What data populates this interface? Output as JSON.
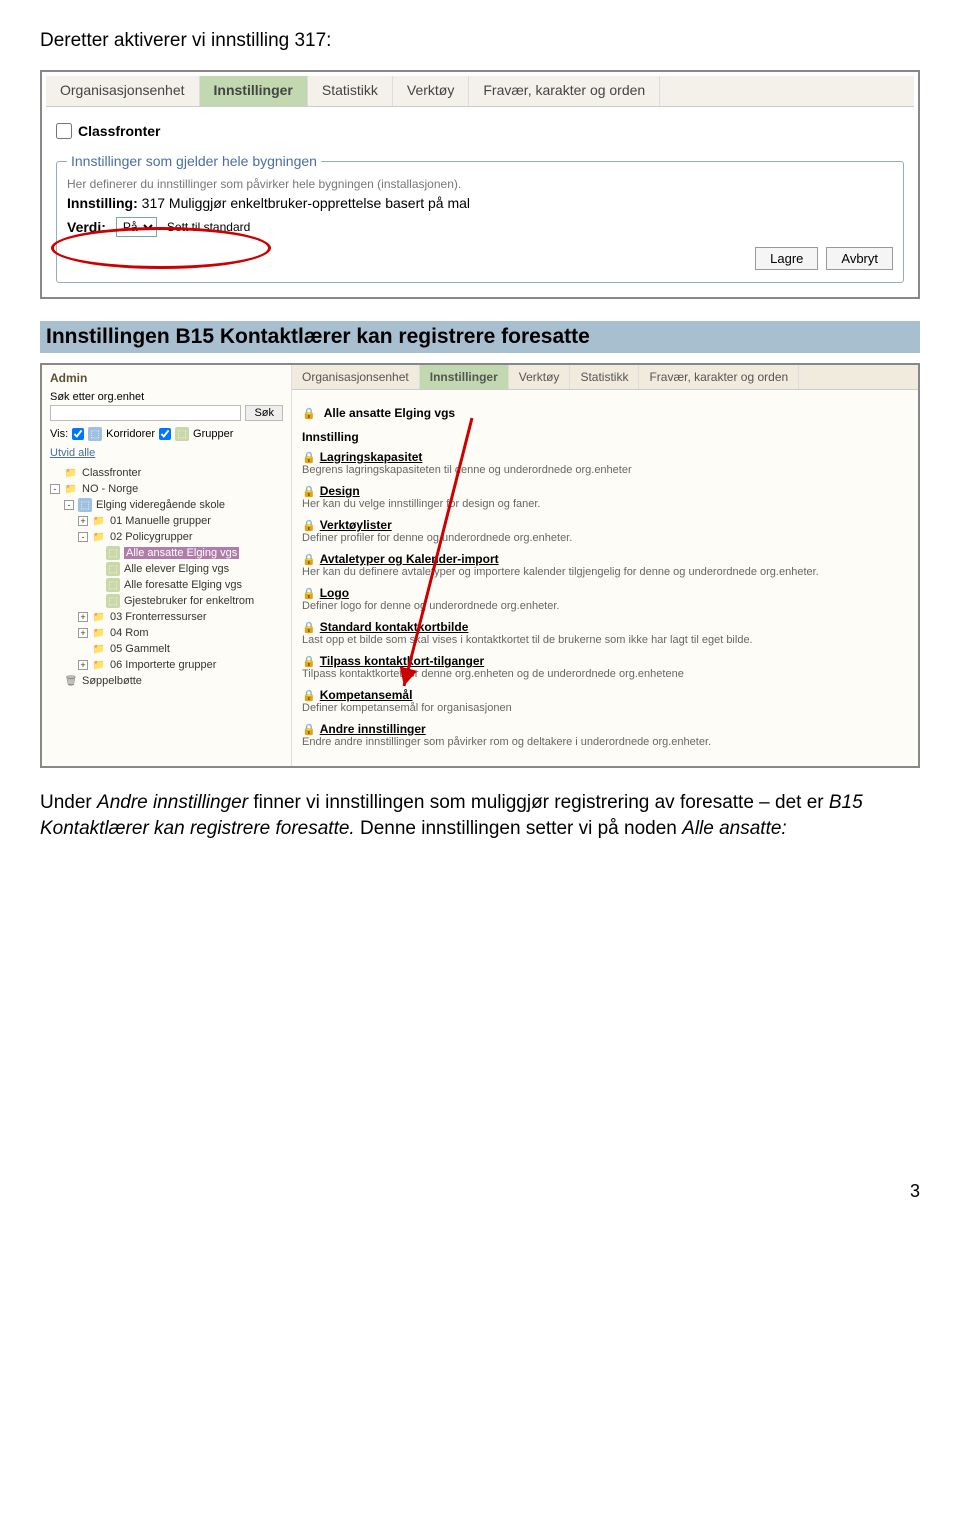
{
  "intro": "Deretter aktiverer vi innstilling 317:",
  "heading": "Innstillingen B15 Kontaktlærer kan registrere foresatte",
  "ss1": {
    "tabs": [
      "Organisasjonsenhet",
      "Innstillinger",
      "Statistikk",
      "Verktøy",
      "Fravær, karakter og orden"
    ],
    "active_tab": 1,
    "checkbox_label": "Classfronter",
    "fieldset_legend": "Innstillinger som gjelder hele bygningen",
    "fieldset_desc": "Her definerer du innstillinger som påvirker hele bygningen (installasjonen).",
    "setting_label": "Innstilling:",
    "setting_text": "317 Muliggjør enkeltbruker-opprettelse basert på mal",
    "verdi_label": "Verdi:",
    "verdi_value": "På",
    "reset_link": "Sett til standard",
    "buttons": [
      "Lagre",
      "Avbryt"
    ]
  },
  "ss2": {
    "admin": "Admin",
    "search_label": "Søk etter org.enhet",
    "search_btn": "Søk",
    "vis_label": "Vis:",
    "korridorer": "Korridorer",
    "grupper": "Grupper",
    "expand": "Utvid alle",
    "tree": [
      {
        "indent": 0,
        "pm": "",
        "icon": "f",
        "label": "Classfronter"
      },
      {
        "indent": 0,
        "pm": "-",
        "icon": "f",
        "label": "NO - Norge"
      },
      {
        "indent": 1,
        "pm": "-",
        "icon": "k",
        "label": "Elging videregående skole"
      },
      {
        "indent": 2,
        "pm": "+",
        "icon": "f",
        "label": "01 Manuelle grupper"
      },
      {
        "indent": 2,
        "pm": "-",
        "icon": "f",
        "label": "02 Policygrupper"
      },
      {
        "indent": 3,
        "pm": "",
        "icon": "g",
        "label": "Alle ansatte Elging vgs",
        "selected": true
      },
      {
        "indent": 3,
        "pm": "",
        "icon": "g",
        "label": "Alle elever Elging vgs"
      },
      {
        "indent": 3,
        "pm": "",
        "icon": "g",
        "label": "Alle foresatte Elging vgs"
      },
      {
        "indent": 3,
        "pm": "",
        "icon": "g",
        "label": "Gjestebruker for enkeltrom"
      },
      {
        "indent": 2,
        "pm": "+",
        "icon": "f",
        "label": "03 Fronterressurser"
      },
      {
        "indent": 2,
        "pm": "+",
        "icon": "f",
        "label": "04 Rom"
      },
      {
        "indent": 2,
        "pm": "",
        "icon": "f",
        "label": "05 Gammelt"
      },
      {
        "indent": 2,
        "pm": "+",
        "icon": "f",
        "label": "06 Importerte grupper"
      },
      {
        "indent": 0,
        "pm": "",
        "icon": "trash",
        "label": "Søppelbøtte"
      }
    ],
    "tabs": [
      "Organisasjonsenhet",
      "Innstillinger",
      "Verktøy",
      "Statistikk",
      "Fravær, karakter og orden"
    ],
    "active_tab": 1,
    "group_title": "Alle ansatte Elging vgs",
    "innstilling_hdr": "Innstilling",
    "items": [
      {
        "t": "Lagringskapasitet",
        "d": "Begrens lagringskapasiteten til denne og underordnede org.enheter"
      },
      {
        "t": "Design",
        "d": "Her kan du velge innstillinger for design og faner."
      },
      {
        "t": "Verktøylister",
        "d": "Definer profiler for denne og underordnede org.enheter."
      },
      {
        "t": "Avtaletyper og Kalender-import",
        "d": "Her kan du definere avtaletyper og importere kalender tilgjengelig for denne og underordnede org.enheter."
      },
      {
        "t": "Logo",
        "d": "Definer logo for denne og underordnede org.enheter."
      },
      {
        "t": "Standard kontaktkortbilde",
        "d": "Last opp et bilde som skal vises i kontaktkortet til de brukerne som ikke har lagt til eget bilde."
      },
      {
        "t": "Tilpass kontaktkort-tilganger",
        "d": "Tilpass kontaktkortet for denne org.enheten og de underordnede org.enhetene"
      },
      {
        "t": "Kompetansemål",
        "d": "Definer kompetansemål for organisasjonen"
      },
      {
        "t": "Andre innstillinger",
        "d": "Endre andre innstillinger som påvirker rom og deltakere i underordnede org.enheter."
      }
    ]
  },
  "body_text_1": "Under ",
  "body_text_em1": "Andre innstillinger",
  "body_text_2": " finner vi innstillingen som muliggjør registrering av foresatte – det er ",
  "body_text_em2": "B15 Kontaktlærer kan registrere foresatte.",
  "body_text_3": " Denne innstillingen setter vi på noden ",
  "body_text_em3": "Alle ansatte:",
  "page_num": "3"
}
